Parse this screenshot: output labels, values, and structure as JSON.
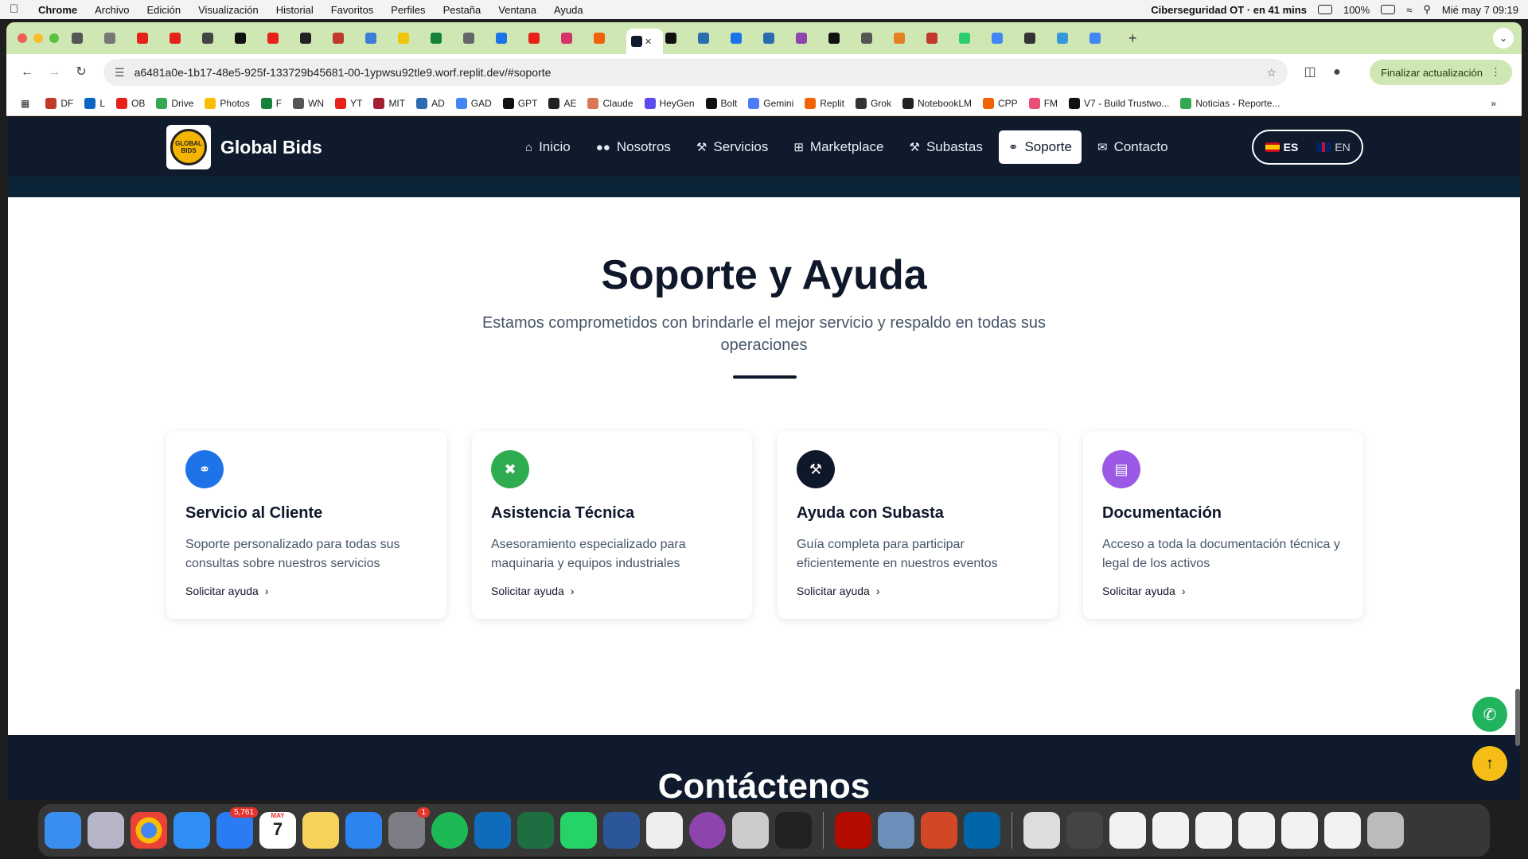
{
  "menubar": {
    "app": "Chrome",
    "items": [
      "Archivo",
      "Edición",
      "Visualización",
      "Historial",
      "Favoritos",
      "Perfiles",
      "Pestaña",
      "Ventana",
      "Ayuda"
    ],
    "status_event": "Ciberseguridad OT · en 41 mins",
    "battery": "100%",
    "datetime": "Mié may 7  09:19"
  },
  "browser": {
    "url": "a6481a0e-1b17-48e5-925f-133729b45681-00-1ypwsu92tle9.worf.replit.dev/#soporte",
    "update_button": "Finalizar actualización",
    "bookmarks": [
      "DF",
      "L",
      "OB",
      "Drive",
      "Photos",
      "F",
      "WN",
      "YT",
      "MIT",
      "AD",
      "GAD",
      "GPT",
      "AE",
      "Claude",
      "HeyGen",
      "Bolt",
      "Gemini",
      "Replit",
      "Grok",
      "NotebookLM",
      "CPP",
      "FM",
      "V7 - Build Trustwo...",
      "Noticias - Reporte..."
    ]
  },
  "site": {
    "brand": "Global Bids",
    "logo_text": "GLOBAL BIDS",
    "nav": [
      {
        "label": "Inicio",
        "icon": "home-icon"
      },
      {
        "label": "Nosotros",
        "icon": "users-icon"
      },
      {
        "label": "Servicios",
        "icon": "wrench-icon"
      },
      {
        "label": "Marketplace",
        "icon": "grid-icon"
      },
      {
        "label": "Subastas",
        "icon": "gavel-icon"
      },
      {
        "label": "Soporte",
        "icon": "headset-icon",
        "active": true
      },
      {
        "label": "Contacto",
        "icon": "envelope-icon"
      }
    ],
    "lang": {
      "es": "ES",
      "en": "EN"
    },
    "section": {
      "title": "Soporte y Ayuda",
      "subtitle": "Estamos comprometidos con brindarle el mejor servicio y respaldo en todas sus operaciones"
    },
    "cards": [
      {
        "title": "Servicio al Cliente",
        "text": "Soporte personalizado para todas sus consultas sobre nuestros servicios",
        "link": "Solicitar ayuda",
        "color": "#1e73e8",
        "icon": "headset-icon"
      },
      {
        "title": "Asistencia Técnica",
        "text": "Asesoramiento especializado para maquinaria y equipos industriales",
        "link": "Solicitar ayuda",
        "color": "#2eac4f",
        "icon": "tools-icon"
      },
      {
        "title": "Ayuda con Subasta",
        "text": "Guía completa para participar eficientemente en nuestros eventos",
        "link": "Solicitar ayuda",
        "color": "#0f172a",
        "icon": "gavel-icon"
      },
      {
        "title": "Documentación",
        "text": "Acceso a toda la documentación técnica y legal de los activos",
        "link": "Solicitar ayuda",
        "color": "#9b59e6",
        "icon": "document-icon"
      }
    ],
    "next_section_title": "Contáctenos"
  },
  "dock": {
    "mail_badge": "5,761",
    "calendar_month": "MAY",
    "calendar_day": "7",
    "settings_badge": "1"
  }
}
